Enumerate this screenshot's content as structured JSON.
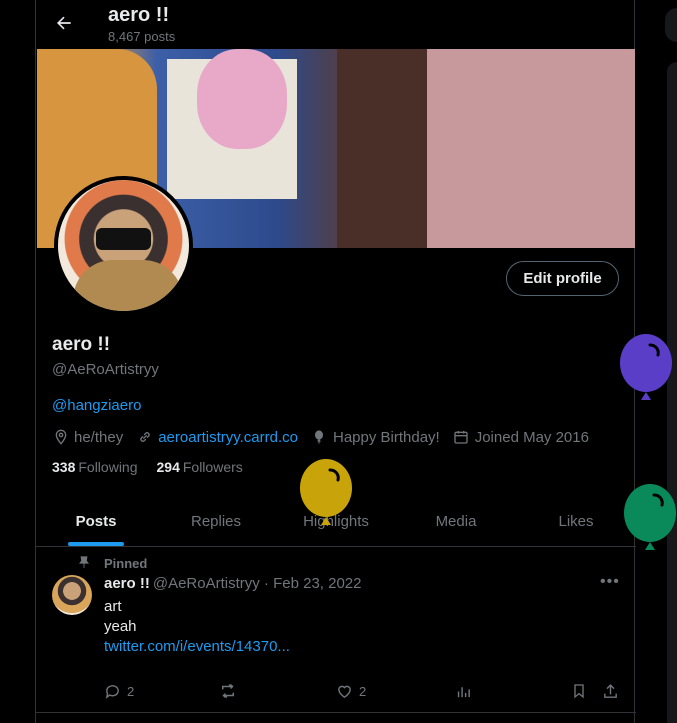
{
  "header": {
    "title": "aero !!",
    "post_count": "8,467 posts"
  },
  "profile": {
    "edit_label": "Edit profile",
    "display_name": "aero !!",
    "handle": "@AeRoArtistryy",
    "bio_mention": "@hangziaero",
    "pronouns": "he/they",
    "website": "aeroartistryy.carrd.co",
    "location": "Happy Birthday!",
    "joined": "Joined May 2016",
    "following_count": "338",
    "following_label": "Following",
    "followers_count": "294",
    "followers_label": "Followers"
  },
  "tabs": [
    {
      "label": "Posts",
      "active": true
    },
    {
      "label": "Replies"
    },
    {
      "label": "Highlights"
    },
    {
      "label": "Media"
    },
    {
      "label": "Likes"
    }
  ],
  "tweet": {
    "pinned_label": "Pinned",
    "name": "aero !!",
    "handle_date": "@AeRoArtistryy · Feb 23, 2022",
    "line1": "art",
    "line2": "yeah",
    "link": "twitter.com/i/events/14370...",
    "reply_count": "2",
    "like_count": "2"
  },
  "colors": {
    "accent": "#1d9bf0",
    "balloon_purple": "#5a3ec8",
    "balloon_gold": "#c8a40a",
    "balloon_green": "#0a8a5a"
  }
}
